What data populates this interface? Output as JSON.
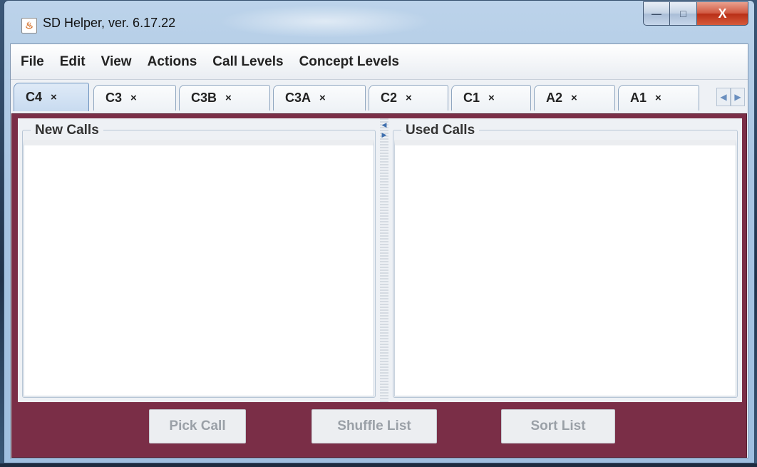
{
  "window": {
    "title": "SD Helper, ver. 6.17.22",
    "icon": "java-app-icon",
    "controls": {
      "minimize": "—",
      "maximize": "□",
      "close": "X"
    }
  },
  "menu": [
    "File",
    "Edit",
    "View",
    "Actions",
    "Call Levels",
    "Concept Levels"
  ],
  "tabs": [
    {
      "label": "C4",
      "selected": true
    },
    {
      "label": "C3",
      "selected": false
    },
    {
      "label": "C3B",
      "selected": false
    },
    {
      "label": "C3A",
      "selected": false
    },
    {
      "label": "C2",
      "selected": false
    },
    {
      "label": "C1",
      "selected": false
    },
    {
      "label": "A2",
      "selected": false
    },
    {
      "label": "A1",
      "selected": false
    }
  ],
  "tab_close_glyph": "×",
  "panels": {
    "new_calls": {
      "title": "New Calls",
      "items": []
    },
    "used_calls": {
      "title": "Used Calls",
      "items": []
    }
  },
  "buttons": {
    "pick": "Pick Call",
    "shuffle": "Shuffle List",
    "sort": "Sort List"
  },
  "colors": {
    "content_background": "#7a2e47",
    "disabled_text": "#9aa0a7"
  }
}
